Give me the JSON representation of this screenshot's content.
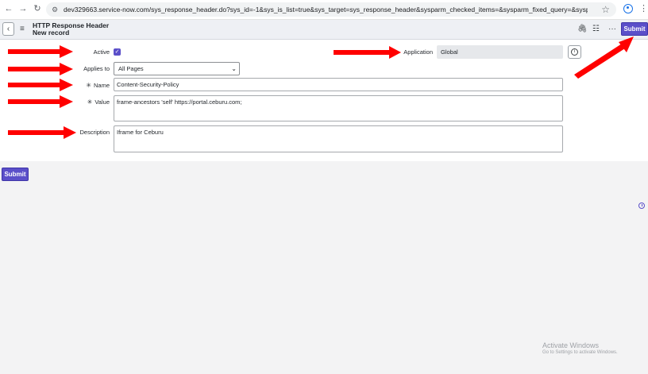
{
  "browser": {
    "url": "dev329663.service-now.com/sys_response_header.do?sys_id=-1&sys_is_list=true&sys_target=sys_response_header&sysparm_checked_items=&sysparm_fixed_query=&sysparm_group_sort=&sysparm_l..."
  },
  "header": {
    "title": "HTTP Response Header",
    "subtitle": "New record",
    "submit_label": "Submit"
  },
  "form": {
    "active": {
      "label": "Active",
      "checked": true
    },
    "applies_to": {
      "label": "Applies to",
      "value": "All Pages"
    },
    "name": {
      "label": "Name",
      "value": "Content-Security-Policy",
      "required_mark": "✳"
    },
    "value": {
      "label": "Value",
      "value": "frame-ancestors 'self' https://portal.ceburu.com;",
      "required_mark": "✳"
    },
    "description": {
      "label": "Description",
      "value": "Iframe for  Ceburu"
    },
    "application": {
      "label": "Application",
      "value": "Global"
    }
  },
  "footer": {
    "submit_label": "Submit"
  },
  "watermark": {
    "line1": "Activate Windows",
    "line2": "Go to Settings to activate Windows."
  },
  "colors": {
    "accent": "#5b4fc9",
    "arrow": "#ff0000",
    "header_bg": "#eef0f4",
    "page_bg": "#f3f3f4"
  }
}
